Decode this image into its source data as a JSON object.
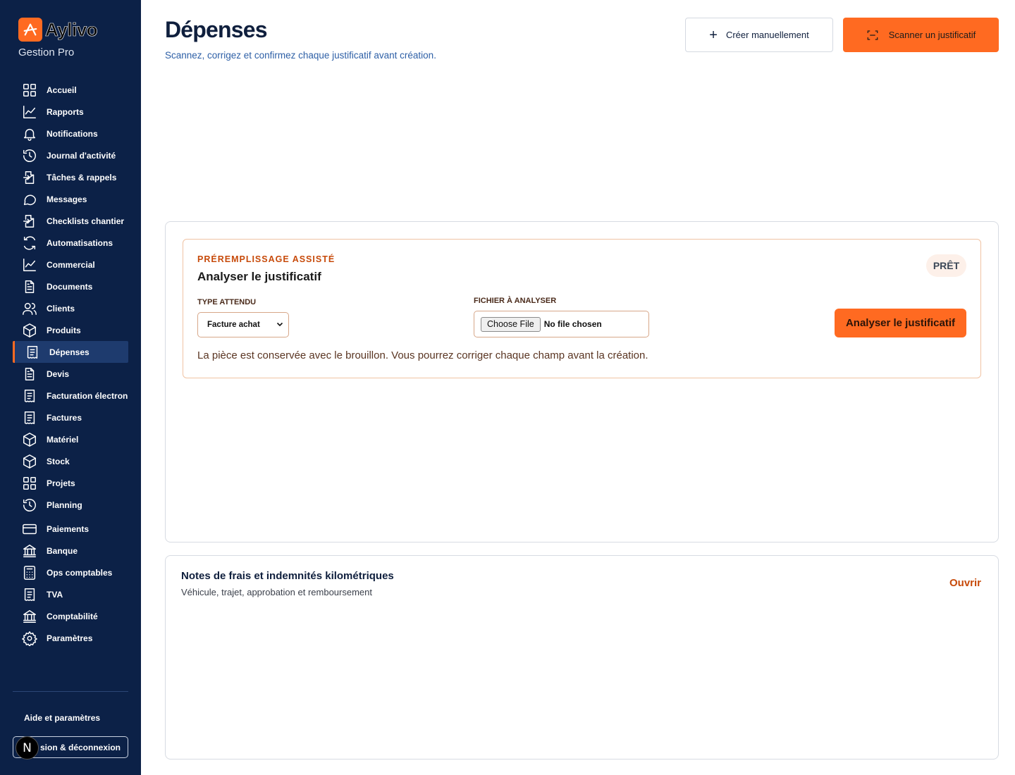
{
  "brand": {
    "name": "Aylivo",
    "subtitle": "Gestion Pro",
    "accent": "#ff6a21",
    "sidebar_bg": "#0c2147"
  },
  "sidebar": {
    "items": [
      {
        "label": "Accueil",
        "icon": "grid-icon"
      },
      {
        "label": "Rapports",
        "icon": "chart-line-icon"
      },
      {
        "label": "Notifications",
        "icon": "bell-icon"
      },
      {
        "label": "Journal d'activité",
        "icon": "history-icon"
      },
      {
        "label": "Tâches & rappels",
        "icon": "file-arrow-icon"
      },
      {
        "label": "Messages",
        "icon": "chat-bubble-icon"
      },
      {
        "label": "Checklists chantier",
        "icon": "file-arrow-icon"
      },
      {
        "label": "Automatisations",
        "icon": "refresh-icon"
      },
      {
        "label": "Commercial",
        "icon": "chart-line-icon"
      },
      {
        "label": "Documents",
        "icon": "document-icon"
      },
      {
        "label": "Clients",
        "icon": "users-icon"
      },
      {
        "label": "Produits",
        "icon": "box-icon"
      },
      {
        "label": "Dépenses",
        "icon": "receipt-icon",
        "active": true
      },
      {
        "label": "Devis",
        "icon": "document-icon"
      },
      {
        "label": "Facturation électronique",
        "icon": "receipt-icon"
      },
      {
        "label": "Factures",
        "icon": "receipt-icon"
      },
      {
        "label": "Matériel",
        "icon": "box-icon"
      },
      {
        "label": "Stock",
        "icon": "box-icon"
      },
      {
        "label": "Projets",
        "icon": "grid-icon"
      },
      {
        "label": "Planning",
        "icon": "history-icon"
      },
      {
        "label": "Paiements",
        "icon": "credit-card-icon"
      },
      {
        "label": "Banque",
        "icon": "bank-icon"
      },
      {
        "label": "Ops comptables",
        "icon": "calculator-icon"
      },
      {
        "label": "TVA",
        "icon": "receipt-icon"
      },
      {
        "label": "Comptabilité",
        "icon": "bank-icon"
      },
      {
        "label": "Paramètres",
        "icon": "gear-icon"
      }
    ],
    "help_label": "Aide et paramètres",
    "logout_label": "sion & déconnexion",
    "avatar_letter": "N"
  },
  "header": {
    "title": "Dépenses",
    "subtitle": "Scannez, corrigez et confirmez chaque justificatif avant création.",
    "create_manual_label": "Créer manuellement",
    "scan_label": "Scanner un justificatif"
  },
  "prefill": {
    "eyebrow": "PRÉREMPLISSAGE ASSISTÉ",
    "title": "Analyser le justificatif",
    "status": "PRÊT",
    "type_label": "TYPE ATTENDU",
    "type_value": "Facture achat",
    "file_label": "FICHIER À ANALYSER",
    "file_button": "Choose File",
    "file_status": "No file chosen",
    "analyze_label": "Analyser le justificatif",
    "hint": "La pièce est conservée avec le brouillon. Vous pourrez corriger chaque champ avant la création."
  },
  "notes": {
    "title": "Notes de frais et indemnités kilométriques",
    "subtitle": "Véhicule, trajet, approbation et remboursement",
    "open_label": "Ouvrir"
  }
}
